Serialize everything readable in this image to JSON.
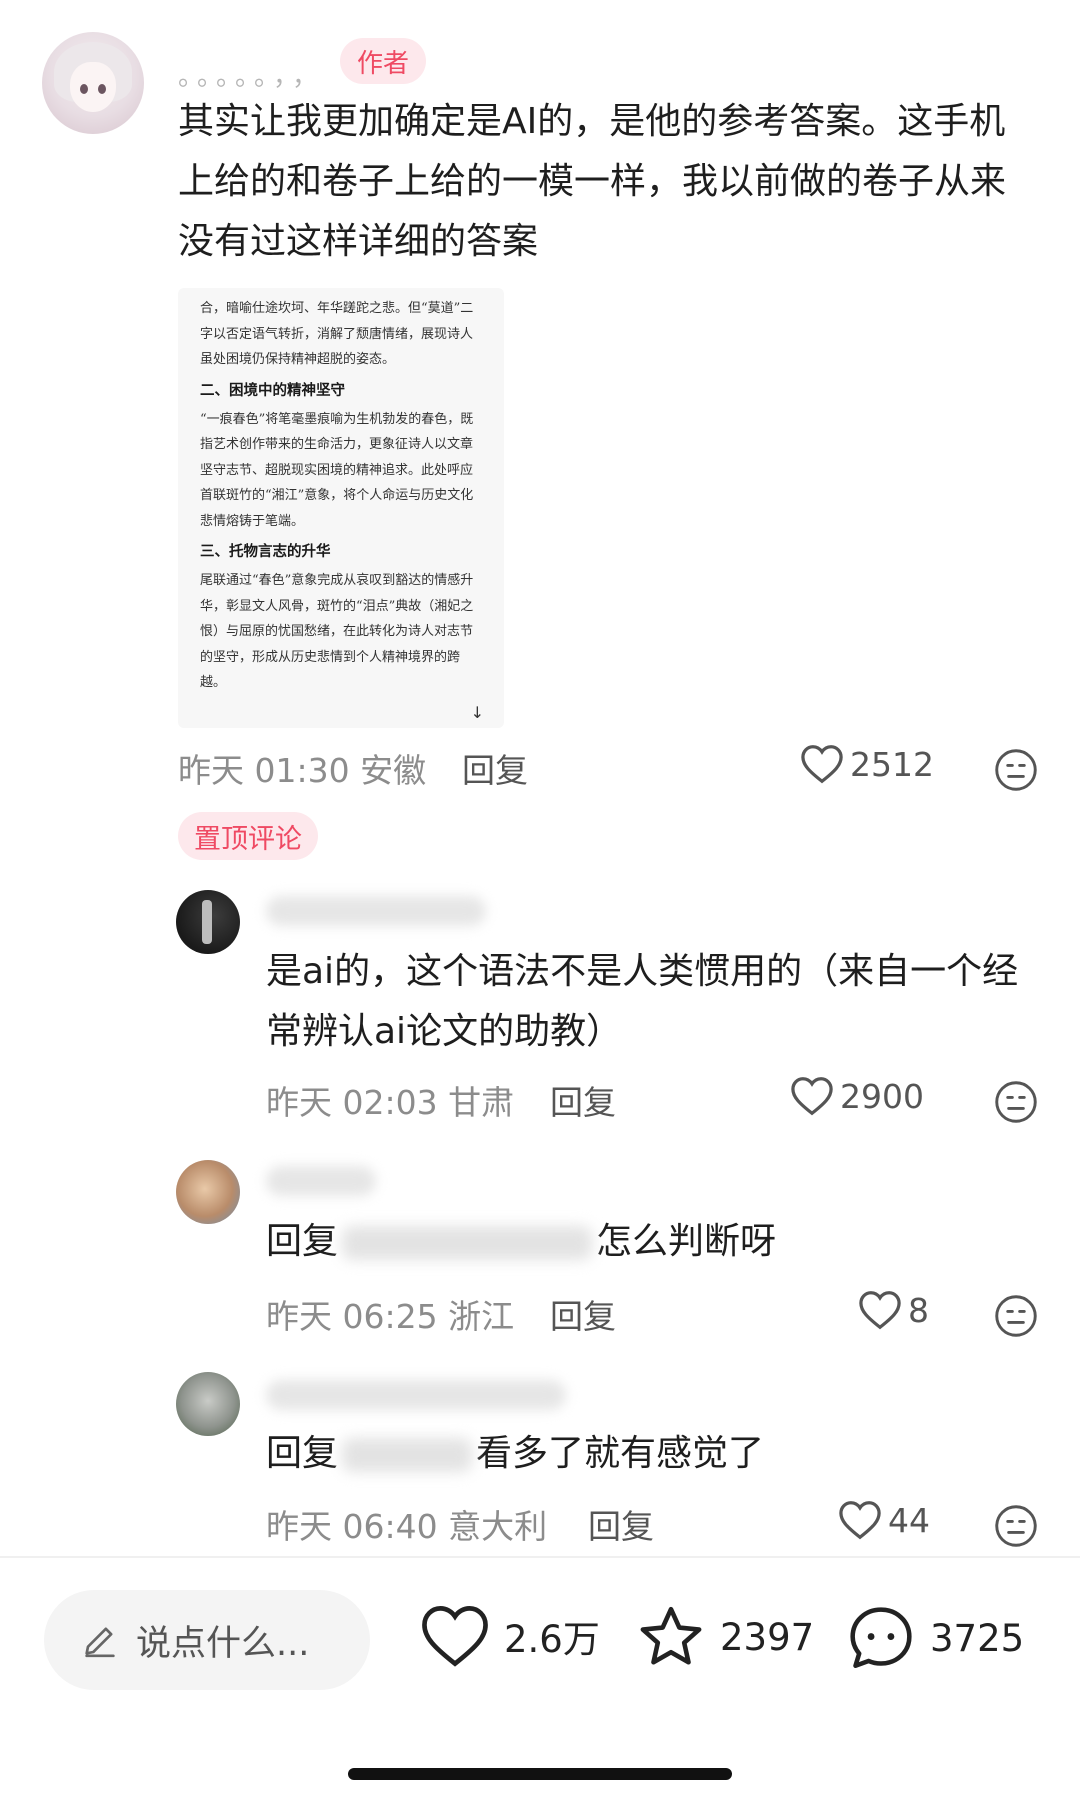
{
  "post": {
    "username": "。。。。。，，",
    "author_badge": "作者",
    "text": "其实让我更加确定是AI的，是他的参考答案。这手机上给的和卷子上给的一模一样，我以前做的卷子从来没有过这样详细的答案",
    "image": {
      "para1": "合，暗喻仕途坎坷、年华蹉跎之悲。但“莫道”二字以否定语气转折，消解了颓唐情绪，展现诗人虽处困境仍保持精神超脱的姿态。",
      "heading2": "二、困境中的精神坚守",
      "para2": "“一痕春色”将笔毫墨痕喻为生机勃发的春色，既指艺术创作带来的生命活力，更象征诗人以文章坚守志节、超脱现实困境的精神追求。此处呼应首联斑竹的“湘江”意象，将个人命运与历史文化悲情熔铸于笔端。",
      "heading3": "三、托物言志的升华",
      "para3": "尾联通过“春色”意象完成从哀叹到豁达的情感升华，彰显文人风骨，斑竹的“泪点”典故（湘妃之恨）与屈原的忧国愁绪，在此转化为诗人对志节的坚守，形成从历史悲情到个人精神境界的跨越。",
      "arrow": "↓"
    },
    "meta": "昨天 01:30 安徽",
    "reply": "回复",
    "likes": "2512"
  },
  "pinned_label": "置顶评论",
  "comments": [
    {
      "text": "是ai的，这个语法不是人类惯用的（来自一个经常辨认ai论文的助教）",
      "meta": "昨天 02:03 甘肃",
      "reply": "回复",
      "likes": "2900"
    },
    {
      "prefix": "回复",
      "suffix": "怎么判断呀",
      "meta": "昨天 06:25 浙江",
      "reply": "回复",
      "likes": "8"
    },
    {
      "prefix": "回复",
      "suffix": "看多了就有感觉了",
      "meta": "昨天 06:40 意大利",
      "reply": "回复",
      "likes": "44"
    }
  ],
  "bottom_bar": {
    "input_placeholder": "说点什么...",
    "likes": "2.6万",
    "stars": "2397",
    "comments": "3725"
  },
  "colors": {
    "accent": "#ef4a63",
    "badge_bg": "#fde8ec",
    "meta": "#8c8c8c"
  },
  "icons": [
    "heart-icon",
    "meh-face-icon",
    "pen-icon",
    "star-icon",
    "chat-bubble-icon"
  ]
}
